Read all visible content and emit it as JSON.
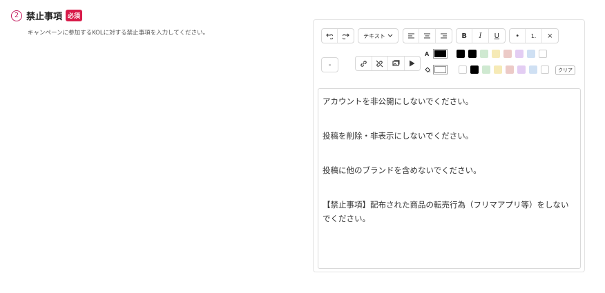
{
  "section": {
    "number": "2",
    "title": "禁止事項",
    "required_badge": "必須",
    "description": "キャンペーンに参加するKOLに対する禁止事項を入力してください。"
  },
  "toolbar": {
    "text_style": "テキスト",
    "bold": "B",
    "italic": "I",
    "underline": "U",
    "bullet_list": "•",
    "ordered_list": "1.",
    "remove_format": "×",
    "minus": "-",
    "text_color_label": "A",
    "clear": "クリア",
    "current_text_color": "#000000",
    "current_bg_color": "#ffffff",
    "text_swatches": [
      "#000000",
      "#000000",
      "#cfe9d1",
      "#f6eab6",
      "#eccac7",
      "#e3cdf3",
      "#cfe0f3",
      "#ffffff"
    ],
    "bg_swatches": [
      "#ffffff",
      "#000000",
      "#cfe9d1",
      "#f6eab6",
      "#eccac7",
      "#e3cdf3",
      "#cfe0f3",
      "#ffffff"
    ]
  },
  "content": {
    "paragraphs": [
      "アカウントを非公開にしないでください。",
      "投稿を削除・非表示にしないでください。",
      "投稿に他のブランドを含めないでください。",
      "【禁止事項】配布された商品の転売行為（フリマアプリ等）をしないでください。"
    ]
  }
}
